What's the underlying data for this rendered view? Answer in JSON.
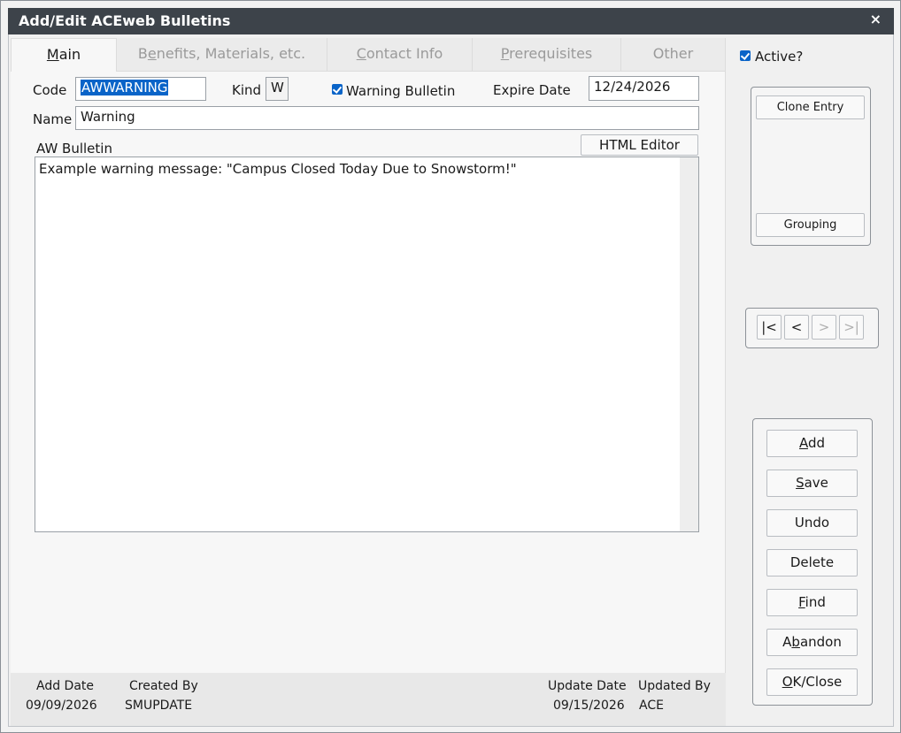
{
  "window": {
    "title": "Add/Edit ACEweb Bulletins",
    "close_glyph": "×"
  },
  "tabs": [
    {
      "label": "Main",
      "mnemonic_pre": "",
      "mnemonic": "M",
      "mnemonic_post": "ain",
      "active": true
    },
    {
      "label": "Benefits, Materials, etc.",
      "mnemonic_pre": "B",
      "mnemonic": "e",
      "mnemonic_post": "nefits, Materials, etc.",
      "active": false
    },
    {
      "label": "Contact Info",
      "mnemonic_pre": "",
      "mnemonic": "C",
      "mnemonic_post": "ontact Info",
      "active": false
    },
    {
      "label": "Prerequisites",
      "mnemonic_pre": "",
      "mnemonic": "P",
      "mnemonic_post": "rerequisites",
      "active": false
    },
    {
      "label": "Other",
      "mnemonic_pre": "",
      "mnemonic": "",
      "mnemonic_post": "Other",
      "active": false
    }
  ],
  "form": {
    "code_label": "Code",
    "code_value": "AWWARNING",
    "kind_label": "Kind",
    "kind_value": "W",
    "warning_label": "Warning Bulletin",
    "warning_checked": true,
    "expire_label": "Expire Date",
    "expire_value": "12/24/2026",
    "name_label": "Name",
    "name_value": "Warning",
    "bulletin_label": "AW Bulletin",
    "html_editor_label": "HTML Editor",
    "bulletin_text": "Example warning message: \"Campus Closed Today Due to Snowstorm!\""
  },
  "footer": {
    "add_date_label": "Add Date",
    "add_date_value": "09/09/2026",
    "created_by_label": "Created By",
    "created_by_value": "SMUPDATE",
    "update_date_label": "Update Date",
    "update_date_value": "09/15/2026",
    "updated_by_label": "Updated By",
    "updated_by_value": "ACE"
  },
  "side": {
    "active_label": "Active?",
    "active_checked": true,
    "clone_label": "Clone Entry",
    "grouping_label": "Grouping",
    "nav": [
      "|<",
      "<",
      ">",
      ">|"
    ],
    "actions": [
      {
        "pre": "",
        "key": "A",
        "post": "dd"
      },
      {
        "pre": "",
        "key": "S",
        "post": "ave"
      },
      {
        "pre": "",
        "key": "",
        "post": "Undo"
      },
      {
        "pre": "",
        "key": "",
        "post": "Delete"
      },
      {
        "pre": "",
        "key": "F",
        "post": "ind"
      },
      {
        "pre": "A",
        "key": "b",
        "post": "andon"
      },
      {
        "pre": "",
        "key": "O",
        "post": "K/Close"
      }
    ]
  },
  "colors": {
    "titlebar": "#3d434a",
    "accent": "#0a64c8"
  }
}
